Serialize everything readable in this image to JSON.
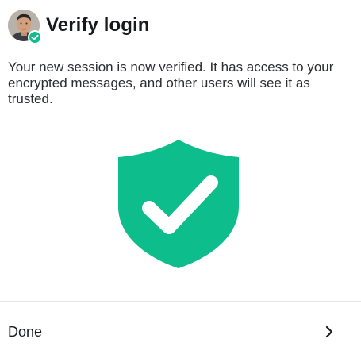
{
  "header": {
    "title": "Verify login",
    "avatar_icon": "user-avatar",
    "badge_icon": "verified-check-icon"
  },
  "body": {
    "description": "Your new session is now verified. It has access to your encrypted messages, and other users will see it as trusted."
  },
  "illustration": {
    "icon": "shield-check-icon",
    "color": "#0dbd8b"
  },
  "footer": {
    "done_label": "Done",
    "chevron_icon": "chevron-right-icon"
  }
}
